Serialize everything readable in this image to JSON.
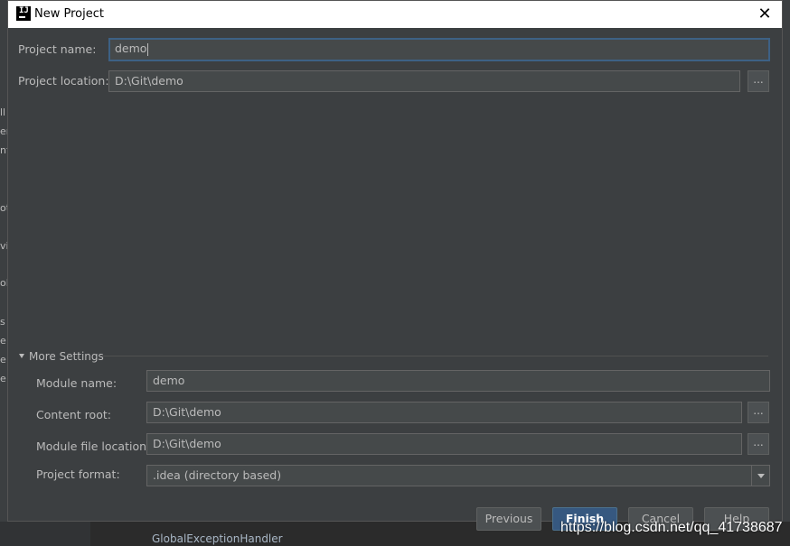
{
  "window": {
    "title": "New Project",
    "close_glyph": "✕"
  },
  "app_icon": {
    "glyph": "IJ",
    "name": "intellij-idea-icon"
  },
  "project": {
    "name_label": "Project name:",
    "name_value": "demo",
    "location_label": "Project location:",
    "location_value": "D:\\Git\\demo",
    "browse_label": "..."
  },
  "more_settings": {
    "toggle_label": "More Settings",
    "expanded": true,
    "module_name_label": "Module name:",
    "module_name_value": "demo",
    "content_root_label": "Content root:",
    "content_root_value": "D:\\Git\\demo",
    "module_file_label": "Module file location:",
    "module_file_value": "D:\\Git\\demo",
    "format_label": "Project format:",
    "format_value": ".idea (directory based)",
    "browse_label": "..."
  },
  "buttons": {
    "previous": "Previous",
    "finish": "Finish",
    "cancel": "Cancel",
    "help": "Help"
  },
  "background": {
    "fragments": [
      "ll",
      "er",
      "nt",
      "ot",
      "vi",
      "ol",
      "s",
      "e",
      "e",
      "e"
    ],
    "bottom_text": "GlobalExceptionHandler"
  },
  "watermark": "https://blog.csdn.net/qq_41738687",
  "colors": {
    "dialog_bg": "#3c3f41",
    "field_bg": "#45494a",
    "focus_border": "#3d6185",
    "primary_button": "#365880"
  }
}
